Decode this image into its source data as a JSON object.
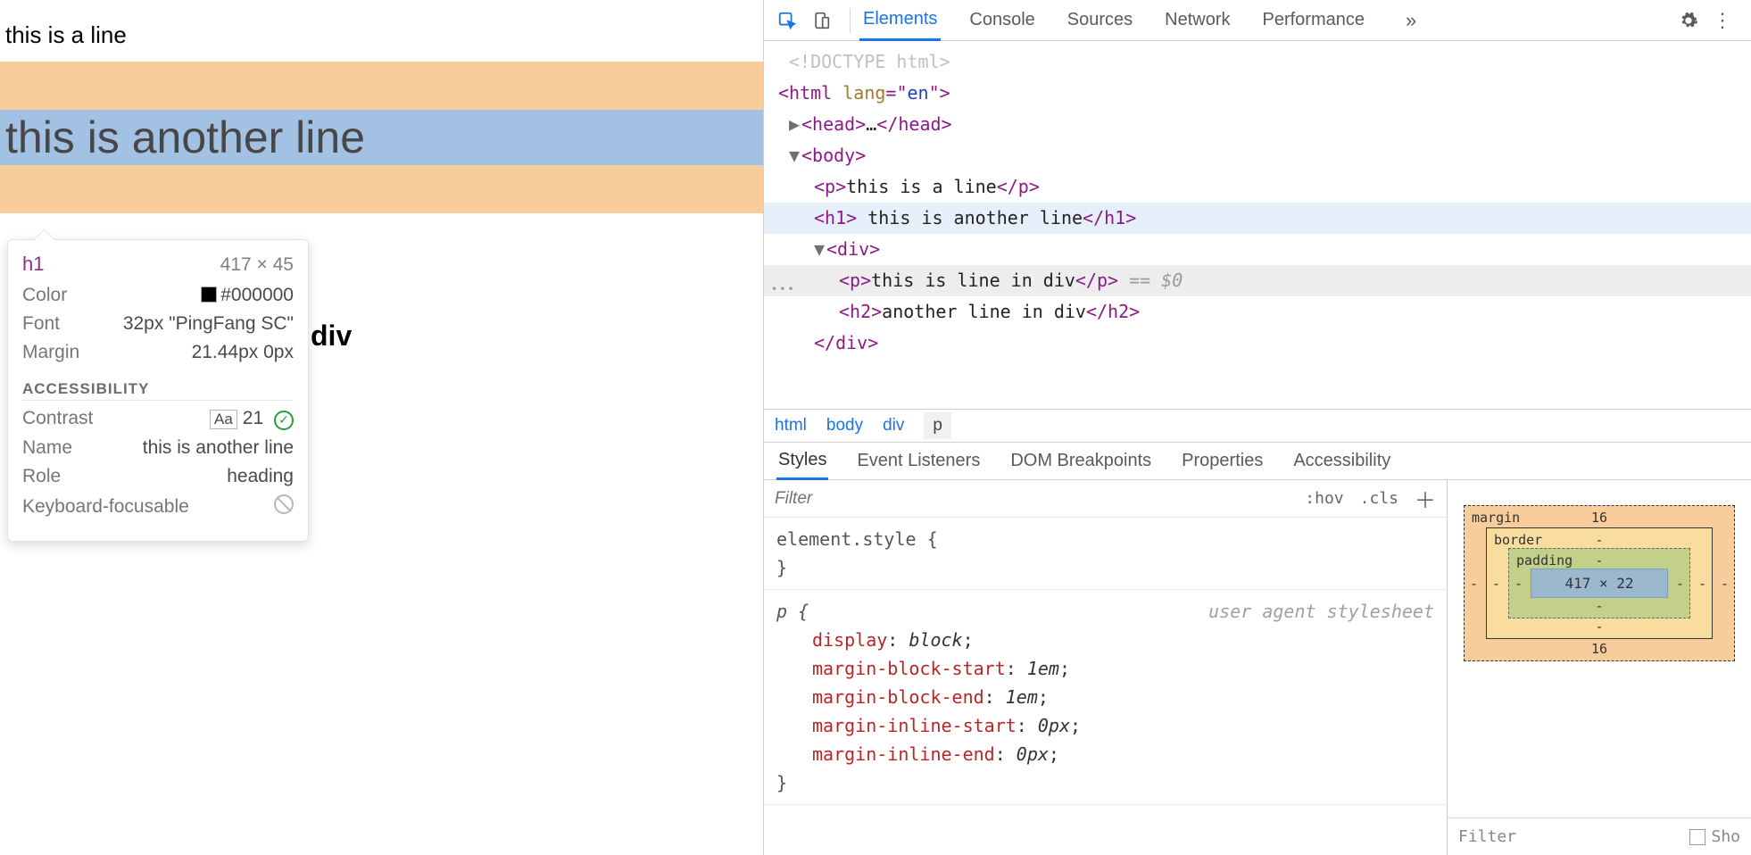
{
  "viewport": {
    "p1": "this is a line",
    "h1": "this is another line",
    "hidden_p_in_div": "this is line in div",
    "hidden_h2_in_div": "another line in div",
    "behind_div_fragment": "div"
  },
  "tooltip": {
    "tag": "h1",
    "dimensions": "417 × 45",
    "rows": {
      "color_label": "Color",
      "color_value": "#000000",
      "font_label": "Font",
      "font_value": "32px \"PingFang SC\"",
      "margin_label": "Margin",
      "margin_value": "21.44px 0px"
    },
    "accessibility_header": "ACCESSIBILITY",
    "a11y": {
      "contrast_label": "Contrast",
      "contrast_aa": "Aa",
      "contrast_value": "21",
      "name_label": "Name",
      "name_value": "this is another line",
      "role_label": "Role",
      "role_value": "heading",
      "kbd_label": "Keyboard-focusable"
    }
  },
  "devtools": {
    "tabs": [
      "Elements",
      "Console",
      "Sources",
      "Network",
      "Performance"
    ],
    "overflow": "»",
    "tree": {
      "l0": "<!DOCTYPE html>",
      "l1_open": "<html lang=\"en\">",
      "l2_head": "<head>…</head>",
      "l3_body": "<body>",
      "l4_p": "this is a line",
      "l5_h1": " this is another line",
      "l6_div": "<div>",
      "l7_p": "this is line in div",
      "l7_sel": " == $0",
      "l8_h2": "another line in div",
      "l9_divend": "</div>"
    },
    "crumbs": [
      "html",
      "body",
      "div",
      "p"
    ],
    "subtabs": [
      "Styles",
      "Event Listeners",
      "DOM Breakpoints",
      "Properties",
      "Accessibility"
    ],
    "styles_filter_placeholder": "Filter",
    "hov": ":hov",
    "cls": ".cls",
    "element_style": "element.style {",
    "element_style_end": "}",
    "origin": "user agent stylesheet",
    "rule_selector": "p {",
    "rule_props": [
      {
        "k": "display",
        "v": "block"
      },
      {
        "k": "margin-block-start",
        "v": "1em"
      },
      {
        "k": "margin-block-end",
        "v": "1em"
      },
      {
        "k": "margin-inline-start",
        "v": "0px"
      },
      {
        "k": "margin-inline-end",
        "v": "0px"
      }
    ],
    "rule_end": "}",
    "boxmodel": {
      "margin_label": "margin",
      "border_label": "border",
      "padding_label": "padding",
      "content": "417 × 22",
      "m_top": "16",
      "m_bot": "16",
      "m_l": "-",
      "m_r": "-",
      "b": "-",
      "p": "-"
    },
    "bm_filter_placeholder": "Filter",
    "bm_show": "Sho"
  }
}
